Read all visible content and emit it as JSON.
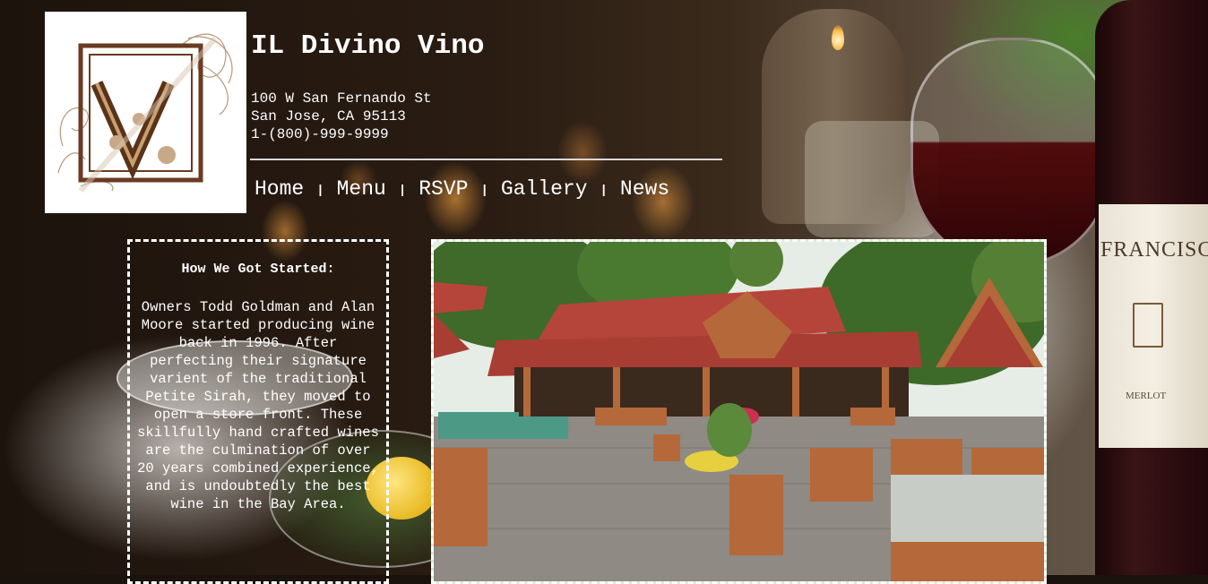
{
  "site": {
    "title": "IL Divino Vino",
    "address": {
      "street": "100 W San Fernando St",
      "city": "San Jose, CA 95113",
      "phone": "1-(800)-999-9999"
    },
    "logo": {
      "icon": "v-monogram-logo",
      "letter": "V"
    }
  },
  "nav": {
    "items": [
      {
        "label": "Home"
      },
      {
        "label": "Menu"
      },
      {
        "label": "RSVP"
      },
      {
        "label": "Gallery"
      },
      {
        "label": "News"
      }
    ],
    "separator": "|"
  },
  "story": {
    "heading": "How We Got Started:",
    "body": "Owners Todd Goldman and Alan Moore started producing wine back in 1996. After perfecting their signature varient of the traditional Petite Sirah, they moved to open a store front. These skillfully hand crafted wines are the culmination of over 20 years combined experience, and is undoubtedly the best wine in the Bay Area."
  },
  "photo": {
    "icon": "outdoor-patio-photo"
  },
  "background": {
    "bottle_label": "FRANCISCAN",
    "bottle_varietal": "MERLOT"
  },
  "colors": {
    "text": "#ffffff",
    "rule": "#d8d8d8",
    "roof": "#b5453a",
    "wood": "#b5683a"
  }
}
